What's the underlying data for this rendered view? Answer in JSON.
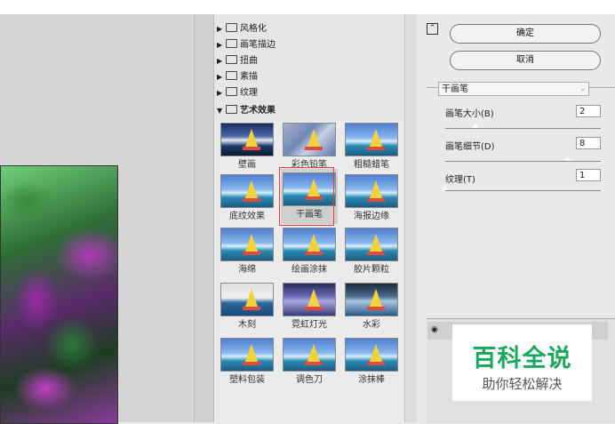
{
  "tree": {
    "folders": [
      {
        "label": "风格化"
      },
      {
        "label": "画笔描边"
      },
      {
        "label": "扭曲"
      },
      {
        "label": "素描"
      },
      {
        "label": "纹理"
      },
      {
        "label": "艺术效果"
      }
    ],
    "thumbnails": [
      {
        "label": "壁画"
      },
      {
        "label": "彩色铅笔"
      },
      {
        "label": "粗糙蜡笔"
      },
      {
        "label": "底纹效果"
      },
      {
        "label": "干画笔"
      },
      {
        "label": "海报边缘"
      },
      {
        "label": "海绵"
      },
      {
        "label": "绘画涂抹"
      },
      {
        "label": "胶片颗粒"
      },
      {
        "label": "木刻"
      },
      {
        "label": "霓虹灯光"
      },
      {
        "label": "水彩"
      },
      {
        "label": "塑料包装"
      },
      {
        "label": "调色刀"
      },
      {
        "label": "涂抹棒"
      }
    ]
  },
  "buttons": {
    "ok": "确定",
    "cancel": "取消"
  },
  "settings": {
    "filter_name": "干画笔",
    "params": [
      {
        "label": "画笔大小(B)",
        "value": "2",
        "level": 0.2
      },
      {
        "label": "画笔细节(D)",
        "value": "8",
        "level": 0.8
      },
      {
        "label": "纹理(T)",
        "value": "1",
        "level": 0.0
      }
    ]
  },
  "watermark": {
    "title": "百科全说",
    "subtitle": "助你轻松解决"
  },
  "colors": {
    "watermark_green": "#1aa85a",
    "selection_red": "#e04040"
  }
}
